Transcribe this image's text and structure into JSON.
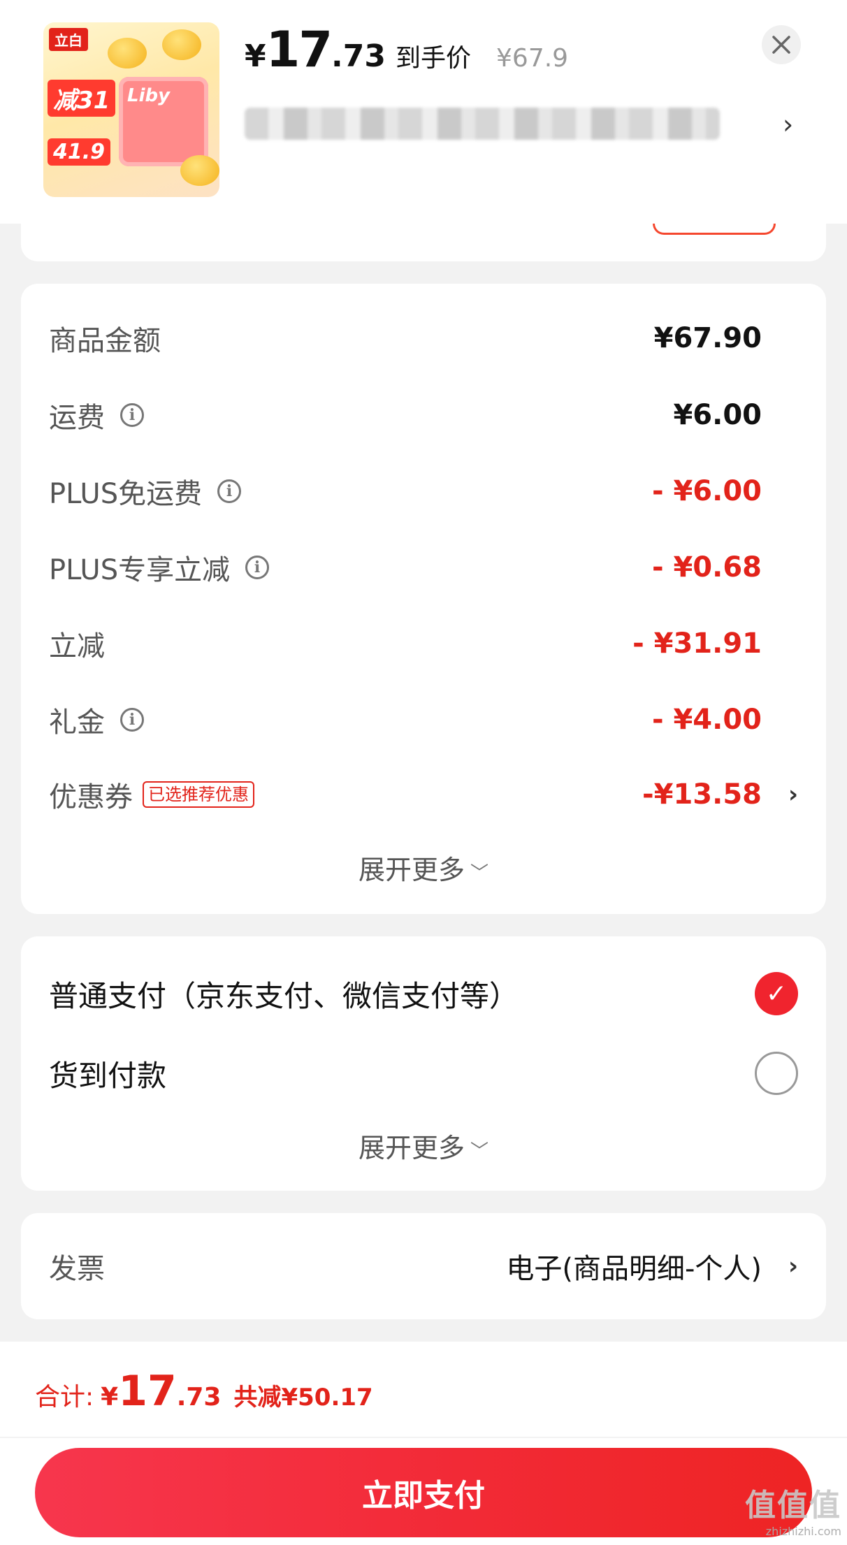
{
  "header": {
    "thumbnail": {
      "brand": "立白",
      "badge_top": "减31",
      "badge_bottom": "41.9",
      "product_brand": "Liby"
    },
    "price": {
      "yen": "¥",
      "integer": "17",
      "decimal": ".73",
      "label": "到手价",
      "original": "¥67.9"
    },
    "close_icon": "close-icon",
    "address_chevron": "›"
  },
  "summary": {
    "rows": [
      {
        "label": "商品金额",
        "value": "¥67.90",
        "info": false,
        "red": false
      },
      {
        "label": "运费",
        "value": "¥6.00",
        "info": true,
        "red": false
      },
      {
        "label": "PLUS免运费",
        "value": "- ¥6.00",
        "info": true,
        "red": true
      },
      {
        "label": "PLUS专享立减",
        "value": "- ¥0.68",
        "info": true,
        "red": true
      },
      {
        "label": "立减",
        "value": "- ¥31.91",
        "info": false,
        "red": true
      },
      {
        "label": "礼金",
        "value": "- ¥4.00",
        "info": true,
        "red": true
      }
    ],
    "coupon": {
      "label": "优惠券",
      "badge": "已选推荐优惠",
      "value": "-¥13.58",
      "chevron": "›"
    },
    "expand_more": "展开更多"
  },
  "payment": {
    "options": [
      {
        "label": "普通支付（京东支付、微信支付等）",
        "selected": true
      },
      {
        "label": "货到付款",
        "selected": false
      }
    ],
    "expand_more": "展开更多",
    "check_mark": "✓"
  },
  "invoice": {
    "label": "发票",
    "value": "电子(商品明细-个人)",
    "chevron": "›"
  },
  "footer": {
    "total_label": "合计:",
    "total_yen": "¥",
    "total_integer": "17",
    "total_decimal": ".73",
    "total_saved": "共减¥50.17",
    "pay_button": "立即支付"
  },
  "watermark": {
    "main": "值值值",
    "sub": "zhizhizhi.com"
  },
  "colors": {
    "accent_red": "#e2231a",
    "button_red": "#f22a36",
    "background": "#f2f2f2"
  }
}
